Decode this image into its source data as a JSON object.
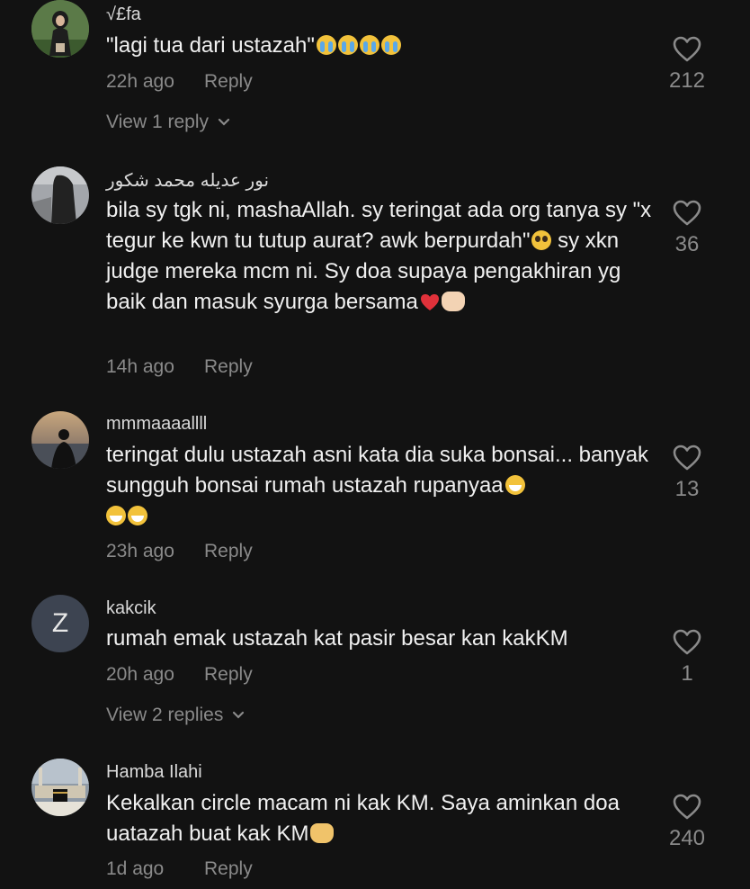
{
  "comments": [
    {
      "username": "√£fa",
      "text": "\"lagi tua dari ustazah\"",
      "time": "22h ago",
      "reply": "Reply",
      "likes": "212",
      "view_replies": "View 1 reply",
      "avatar_icon": "hijab-person-photo"
    },
    {
      "username": "نور عديله محمد شكور",
      "text": "bila sy tgk ni, mashaAllah. sy teringat ada org tanya sy \"x tegur ke kwn tu tutup aurat? awk berpurdah\"",
      "text2": " sy xkn judge mereka mcm ni. Sy doa supaya pengakhiran yg baik dan masuk syurga bersama",
      "time": "14h ago",
      "reply": "Reply",
      "likes": "36",
      "avatar_icon": "veiled-person-photo"
    },
    {
      "username": "mmmaaaallll",
      "text": "teringat dulu ustazah asni kata dia suka bonsai... banyak sungguh bonsai rumah ustazah rupanyaa",
      "time": "23h ago",
      "reply": "Reply",
      "likes": "13",
      "avatar_icon": "silhouette-sunset-photo"
    },
    {
      "username": "kakcik",
      "text": "rumah emak ustazah kat pasir besar kan kakKM",
      "time": "20h ago",
      "reply": "Reply",
      "likes": "1",
      "view_replies": "View 2 replies",
      "avatar_letter": "Z"
    },
    {
      "username": "Hamba Ilahi",
      "text": "Kekalkan circle macam ni kak KM. Saya aminkan doa uatazah buat kak KM",
      "time": "1d ago",
      "reply": "Reply",
      "likes": "240",
      "avatar_icon": "mosque-kaaba-photo"
    }
  ],
  "colors": {
    "background": "#121212",
    "primary_text": "#f0f0f0",
    "secondary_text": "#8a8a8a",
    "avatar_letter_bg": "#3d4451"
  }
}
